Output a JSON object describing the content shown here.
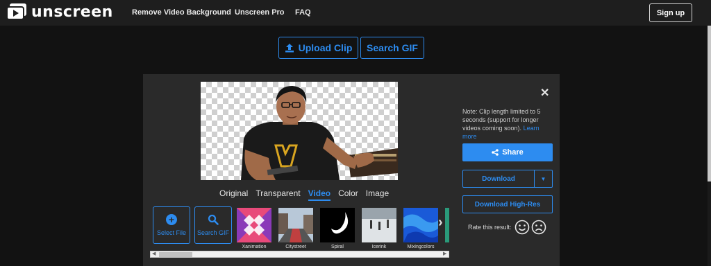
{
  "nav": {
    "logo_text": "unscreen",
    "links": [
      "Remove Video Background",
      "Unscreen Pro",
      "FAQ"
    ],
    "signup_label": "Sign up"
  },
  "actions": {
    "upload_label": "Upload Clip",
    "search_gif_label": "Search GIF"
  },
  "preview": {
    "tabs": [
      "Original",
      "Transparent",
      "Video",
      "Color",
      "Image"
    ],
    "active_tab": "Video"
  },
  "backgrounds": {
    "select_file_label": "Select File",
    "search_gif_label": "Search GIF",
    "items": [
      {
        "label": "Xanimation"
      },
      {
        "label": "Citystreet"
      },
      {
        "label": "Spiral"
      },
      {
        "label": "Icerink"
      },
      {
        "label": "Mixingcolors"
      }
    ]
  },
  "sidebar": {
    "note_text": "Note: Clip length limited to 5 seconds (support for longer videos coming soon).",
    "note_link": "Learn more",
    "share_label": "Share",
    "download_label": "Download",
    "download_hires_label": "Download High-Res",
    "rate_label": "Rate this result:"
  },
  "colors": {
    "accent": "#2d8cf0",
    "page_bg": "#121212",
    "panel_bg": "#2a2a2a"
  }
}
